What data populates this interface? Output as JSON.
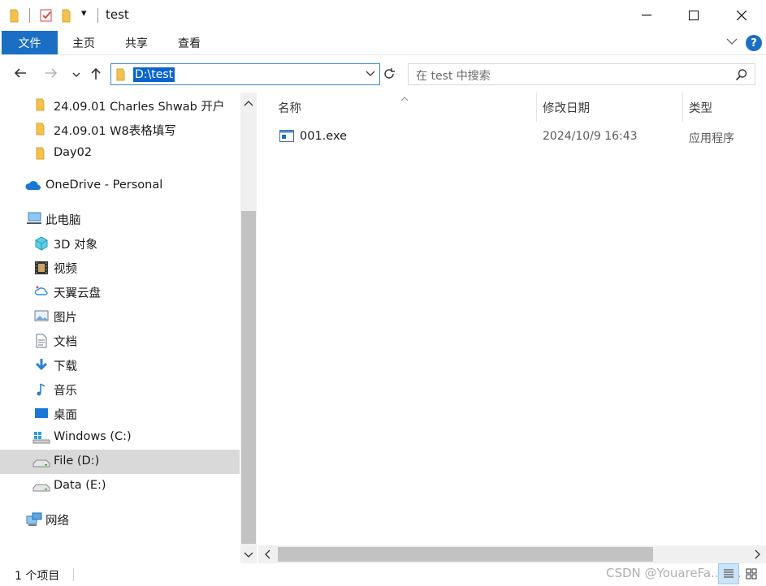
{
  "window": {
    "title": "test",
    "quick_access_dropdown": "▾",
    "minimize": "—",
    "maximize": "☐",
    "close": "✕"
  },
  "ribbon": {
    "tabs": [
      "文件",
      "主页",
      "共享",
      "查看"
    ],
    "help": "?"
  },
  "address": {
    "path": "D:\\test",
    "search_placeholder": "在 test 中搜索"
  },
  "nav": {
    "items": [
      {
        "label": "24.09.01 Charles Shwab 开户",
        "icon": "folder-icon"
      },
      {
        "label": "24.09.01 W8表格填写",
        "icon": "folder-icon"
      },
      {
        "label": "Day02",
        "icon": "folder-icon"
      },
      {
        "label": "OneDrive - Personal",
        "icon": "cloud-icon"
      },
      {
        "label": "此电脑",
        "icon": "computer-icon"
      },
      {
        "label": "3D 对象",
        "icon": "cube-icon"
      },
      {
        "label": "视频",
        "icon": "film-icon"
      },
      {
        "label": "天翼云盘",
        "icon": "cloud-disk-icon"
      },
      {
        "label": "图片",
        "icon": "picture-icon"
      },
      {
        "label": "文档",
        "icon": "document-icon"
      },
      {
        "label": "下载",
        "icon": "download-icon"
      },
      {
        "label": "音乐",
        "icon": "music-icon"
      },
      {
        "label": "桌面",
        "icon": "desktop-icon"
      },
      {
        "label": "Windows (C:)",
        "icon": "windows-drive-icon"
      },
      {
        "label": "File (D:)",
        "icon": "drive-icon"
      },
      {
        "label": "Data (E:)",
        "icon": "drive-icon"
      },
      {
        "label": "网络",
        "icon": "network-icon"
      }
    ]
  },
  "content": {
    "columns": [
      "名称",
      "修改日期",
      "类型"
    ],
    "files": [
      {
        "name": "001.exe",
        "modified": "2024/10/9 16:43",
        "type": "应用程序"
      }
    ]
  },
  "status": {
    "item_count": "1 个项目",
    "watermark": "CSDN @YouareFa...f...."
  },
  "colors": {
    "accent": "#1a6fc4",
    "selection": "#0a64d0",
    "nav_selected": "#d9d9d9",
    "folder": "#f2c14e"
  }
}
